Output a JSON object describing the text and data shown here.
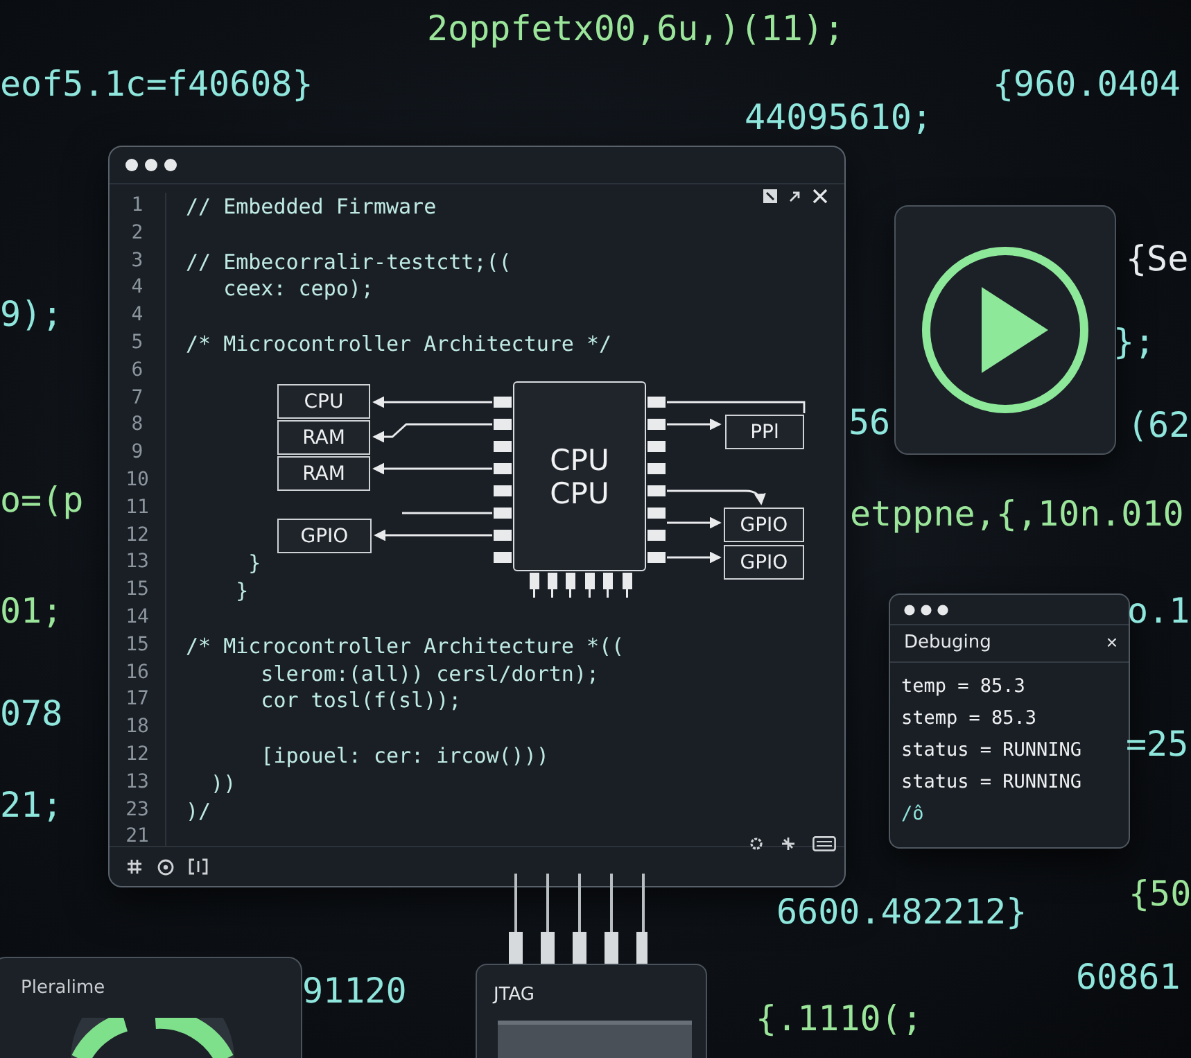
{
  "background_code": [
    {
      "text": "2oppfetx00,6u,)(11);",
      "color": "#9be59a"
    },
    {
      "text": "eof5.1c=f40608}",
      "color": "#8fe6dc"
    },
    {
      "text": "{960.0404",
      "color": "#8fe6dc"
    },
    {
      "text": "44095610;",
      "color": "#8fe6dc"
    },
    {
      "text": "{Se",
      "color": "#e8ecef"
    },
    {
      "text": "9);",
      "color": "#8fe6dc"
    },
    {
      "text": "};",
      "color": "#8fe6dc"
    },
    {
      "text": "56",
      "color": "#8fe6dc"
    },
    {
      "text": "(62",
      "color": "#8fe6dc"
    },
    {
      "text": "o=(p",
      "color": "#9be59a"
    },
    {
      "text": "etppne,{,10n.010",
      "color": "#9be59a"
    },
    {
      "text": "01;",
      "color": "#9be59a"
    },
    {
      "text": "o.1",
      "color": "#8fe6dc"
    },
    {
      "text": "078",
      "color": "#8fe6dc"
    },
    {
      "text": "=25",
      "color": "#8fe6dc"
    },
    {
      "text": "21;",
      "color": "#8fe6dc"
    },
    {
      "text": "6600.482212}",
      "color": "#8fe6dc"
    },
    {
      "text": "{50",
      "color": "#9be59a"
    },
    {
      "text": "91120",
      "color": "#8fe6dc"
    },
    {
      "text": "60861",
      "color": "#8fe6dc"
    },
    {
      "text": "{.1110(;",
      "color": "#9be59a"
    }
  ],
  "editor": {
    "lines": [
      {
        "number": "1",
        "code": "// Embedded Firmware"
      },
      {
        "number": "2"
      },
      {
        "number": "3",
        "code": "// Embecorralir-testctt;(("
      },
      {
        "number": "4",
        "code": "   ceex: cepo);"
      },
      {
        "number": "4"
      },
      {
        "number": "5",
        "code": "/* Microcontroller Architecture */"
      },
      {
        "number": "6"
      },
      {
        "number": "7"
      },
      {
        "number": "8"
      },
      {
        "number": "9"
      },
      {
        "number": "10"
      },
      {
        "number": "11"
      },
      {
        "number": "12"
      },
      {
        "number": "13",
        "code": "     }"
      },
      {
        "number": "15",
        "code": "    }"
      },
      {
        "number": "14"
      },
      {
        "number": "15",
        "code": "/* Microcontroller Architecture *(("
      },
      {
        "number": "16",
        "code": "      slerom:(all)) cersl/dortn);"
      },
      {
        "number": "17",
        "code": "      cor tosl(f(sl));"
      },
      {
        "number": "18"
      },
      {
        "number": "12",
        "code": "      [ipouel: cer: ircow()))"
      },
      {
        "number": "13",
        "code": "  ))"
      },
      {
        "number": "23",
        "code": ")/"
      },
      {
        "number": "21"
      }
    ],
    "diagram": {
      "chip_labels": [
        "CPU",
        "CPU"
      ],
      "left_blocks": [
        "CPU",
        "RAM",
        "RAM",
        "GPIO"
      ],
      "right_blocks": [
        "PPl",
        "GPIO",
        "GPIO"
      ]
    }
  },
  "debug_panel": {
    "title": "Debuging",
    "close": "×",
    "lines": [
      "temp = 85.3",
      "stemp = 85.3",
      "status = RUNNING",
      "status = RUNNING",
      "/ô"
    ]
  },
  "gauge_panel": {
    "title": "Pleralime"
  },
  "jtag_panel": {
    "title": "JTAG"
  }
}
